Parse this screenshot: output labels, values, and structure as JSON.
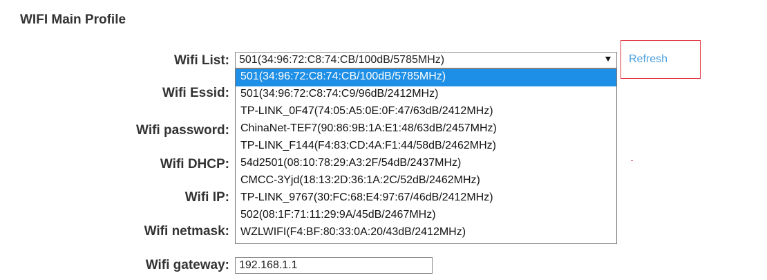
{
  "section_title": "WIFI Main Profile",
  "labels": {
    "wifi_list": "Wifi List:",
    "wifi_essid": "Wifi Essid:",
    "wifi_password": "Wifi password:",
    "wifi_dhcp": "Wifi DHCP:",
    "wifi_ip": "Wifi IP:",
    "wifi_netmask": "Wifi netmask:",
    "wifi_gateway": "Wifi gateway:"
  },
  "wifi_list": {
    "selected": "501(34:96:72:C8:74:CB/100dB/5785MHz)",
    "options": [
      "501(34:96:72:C8:74:CB/100dB/5785MHz)",
      "501(34:96:72:C8:74:C9/96dB/2412MHz)",
      "TP-LINK_0F47(74:05:A5:0E:0F:47/63dB/2412MHz)",
      "ChinaNet-TEF7(90:86:9B:1A:E1:48/63dB/2457MHz)",
      "TP-LINK_F144(F4:83:CD:4A:F1:44/58dB/2462MHz)",
      "54d2501(08:10:78:29:A3:2F/54dB/2437MHz)",
      "CMCC-3Yjd(18:13:2D:36:1A:2C/52dB/2462MHz)",
      "TP-LINK_9767(30:FC:68:E4:97:67/46dB/2412MHz)",
      "502(08:1F:71:11:29:9A/45dB/2467MHz)",
      "WZLWIFI(F4:BF:80:33:0A:20/43dB/2412MHz)"
    ]
  },
  "refresh_label": "Refresh",
  "wifi_gateway_value": "192.168.1.1",
  "colors": {
    "selected_option_bg": "#1e8fe6",
    "refresh_link": "#4a9fe0",
    "refresh_border": "#e0303a"
  }
}
